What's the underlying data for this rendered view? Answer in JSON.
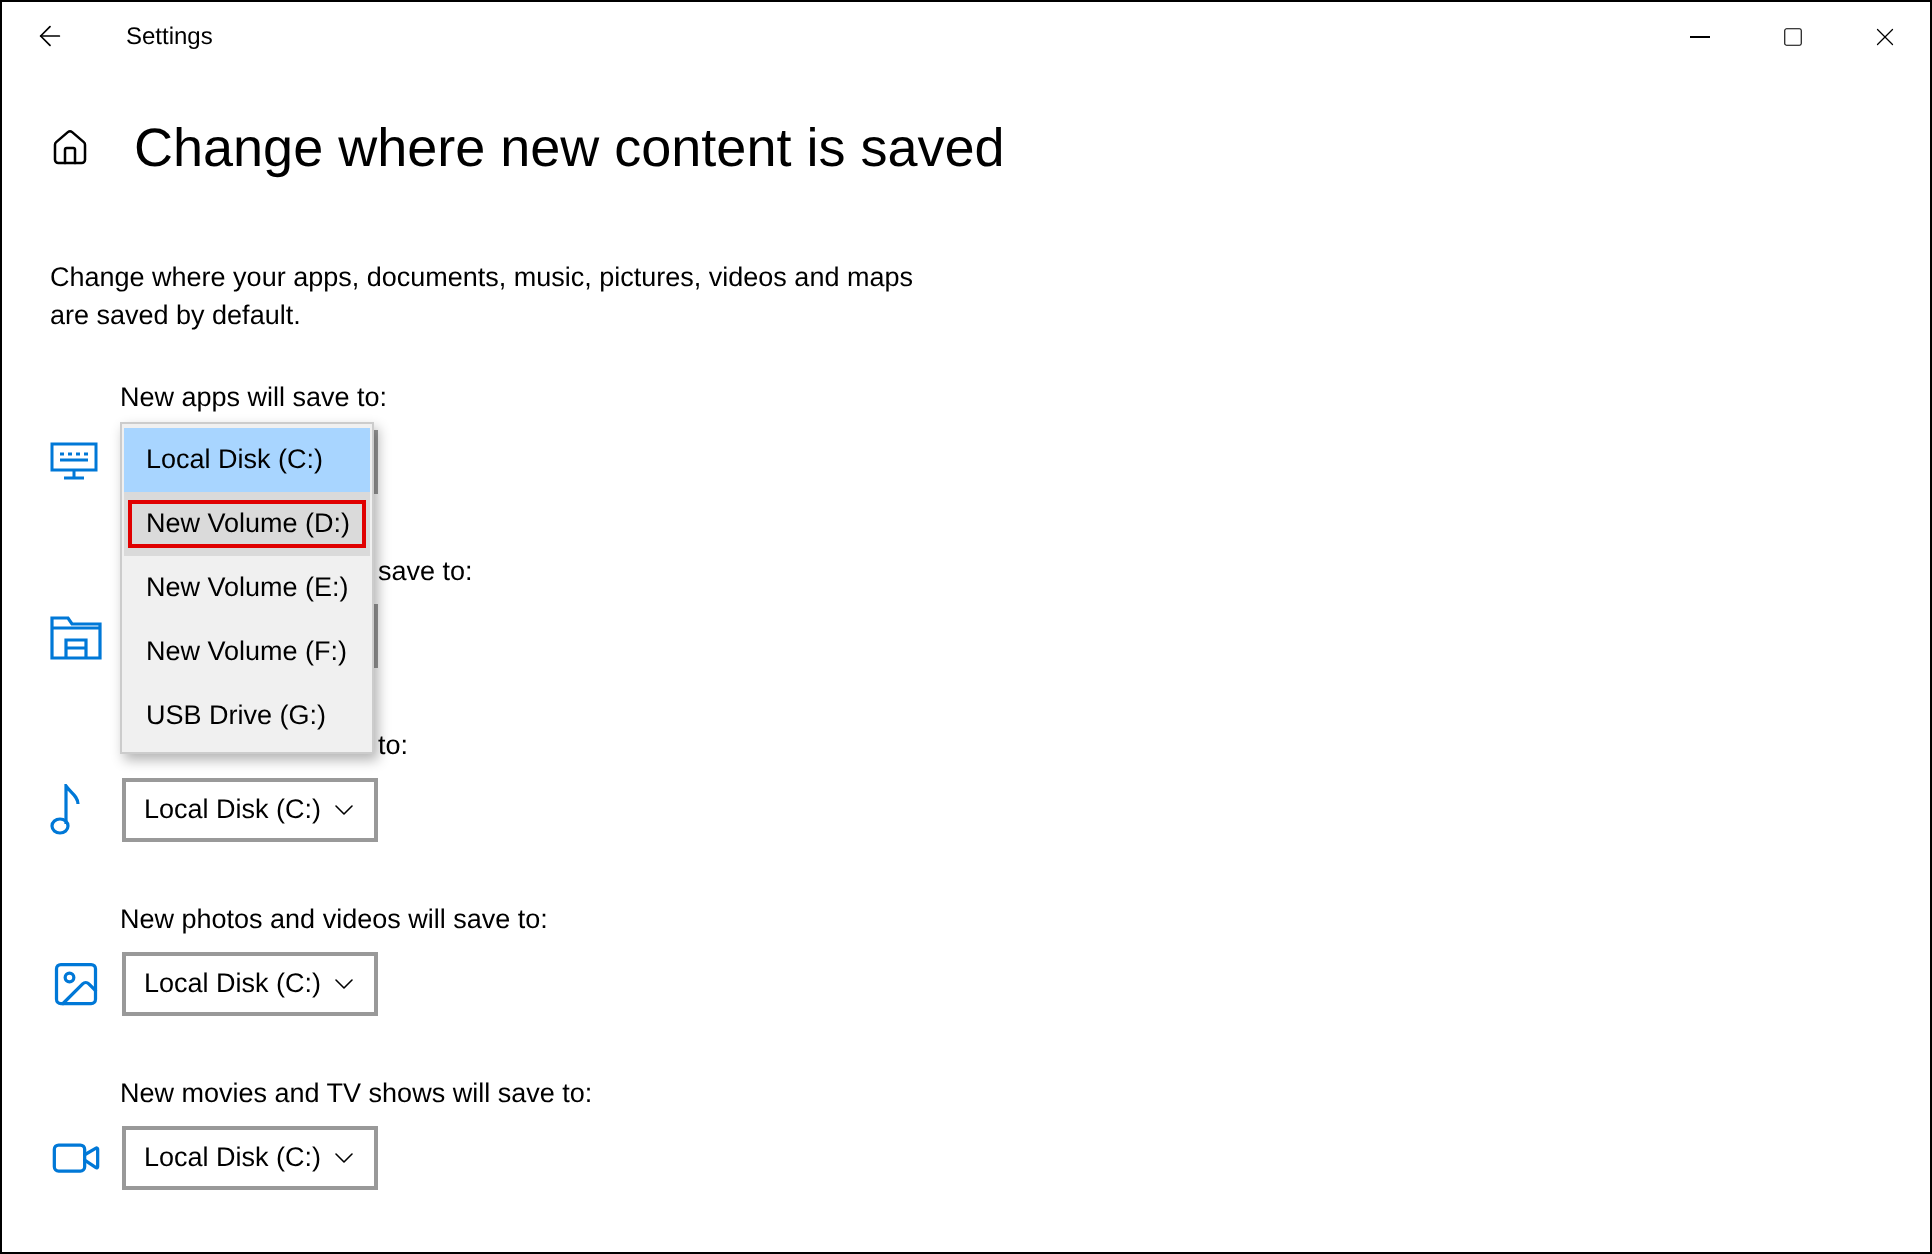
{
  "window": {
    "title": "Settings"
  },
  "page": {
    "title": "Change where new content is saved",
    "description": "Change where your apps, documents, music, pictures, videos and maps are saved by default."
  },
  "sections": [
    {
      "label": "New apps will save to:"
    },
    {
      "label": "save to:",
      "partly_hidden": true
    },
    {
      "label": "to:",
      "partly_hidden": true,
      "value": "Local Disk (C:)"
    },
    {
      "label": "New photos and videos will save to:",
      "value": "Local Disk (C:)"
    },
    {
      "label": "New movies and TV shows will save to:",
      "value": "Local Disk (C:)"
    }
  ],
  "dropdown": {
    "options": [
      {
        "label": "Local Disk (C:)",
        "selected": true,
        "highlighted": false
      },
      {
        "label": "New Volume (D:)",
        "selected": false,
        "highlighted": true
      },
      {
        "label": "New Volume (E:)",
        "selected": false,
        "highlighted": false
      },
      {
        "label": "New Volume (F:)",
        "selected": false,
        "highlighted": false
      },
      {
        "label": "USB Drive (G:)",
        "selected": false,
        "highlighted": false
      }
    ]
  }
}
